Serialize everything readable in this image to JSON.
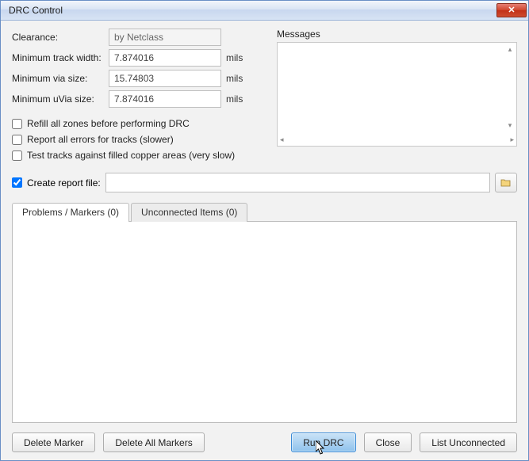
{
  "window": {
    "title": "DRC Control"
  },
  "form": {
    "clearance_label": "Clearance:",
    "clearance_value": "by Netclass",
    "track_label": "Minimum track width:",
    "track_value": "7.874016",
    "via_label": "Minimum via size:",
    "via_value": "15.74803",
    "uvia_label": "Minimum uVia size:",
    "uvia_value": "7.874016",
    "unit": "mils"
  },
  "checks": {
    "refill": "Refill all zones before performing DRC",
    "report_all": "Report all errors for tracks (slower)",
    "test_copper": "Test tracks against filled copper areas (very slow)",
    "create_report": "Create report file:"
  },
  "messages": {
    "label": "Messages"
  },
  "report": {
    "path": ""
  },
  "tabs": {
    "problems": "Problems / Markers (0)",
    "unconnected": "Unconnected Items (0)"
  },
  "buttons": {
    "delete_marker": "Delete Marker",
    "delete_all": "Delete All Markers",
    "run": "Run DRC",
    "close": "Close",
    "list_unconnected": "List Unconnected"
  }
}
